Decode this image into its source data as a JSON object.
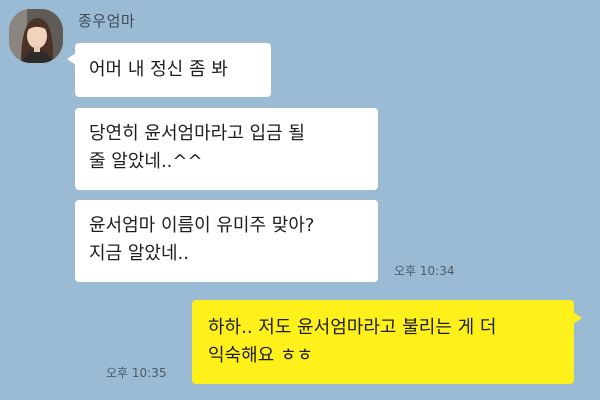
{
  "conversation": {
    "sender": {
      "name": "종우엄마",
      "avatar": "avatar-photo"
    },
    "incoming_color": "#ffffff",
    "outgoing_color": "#fef01b",
    "background_color": "#9bbbd4",
    "messages": [
      {
        "direction": "in",
        "lines": [
          "어머 내 정신 좀 봐"
        ]
      },
      {
        "direction": "in",
        "lines": [
          "당연히 윤서엄마라고 입금 될",
          "줄 알았네..^^"
        ]
      },
      {
        "direction": "in",
        "lines": [
          "윤서엄마 이름이 유미주 맞아?",
          "지금 알았네.."
        ],
        "time": "오후 10:34"
      },
      {
        "direction": "out",
        "lines": [
          "하하.. 저도 윤서엄마라고 불리는 게 더",
          "익숙해요 ㅎㅎ"
        ],
        "time": "오후 10:35"
      }
    ]
  }
}
